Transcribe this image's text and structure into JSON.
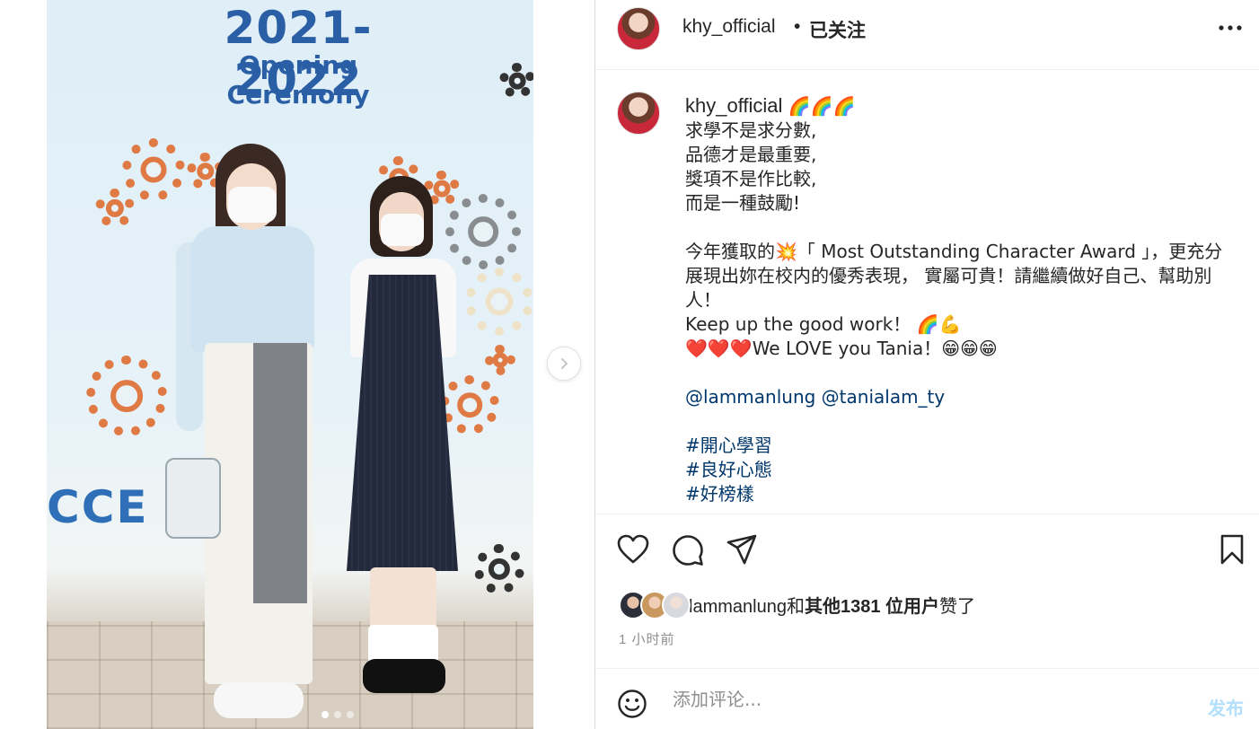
{
  "post": {
    "username": "khy_official",
    "separator": "•",
    "follow_state": "已关注",
    "more_icon": "more-options-icon"
  },
  "photo": {
    "banner_year": "2021-2022",
    "banner_subtitle": "Opening Ceremony",
    "banner_bottom": "CCE      GETH",
    "carousel_dots": 3,
    "carousel_active_index": 0
  },
  "caption": {
    "username": "khy_official",
    "user_emoji": "🌈🌈🌈",
    "lines": [
      "求學不是求分數,",
      "品德才是最重要,",
      "獎項不是作比較,",
      "而是一種鼓勵!",
      "",
      "今年獲取的💥「 Most Outstanding Character Award 」，更充分展現出妳在校内的優秀表現， 實屬可貴！請繼續做好自己、幫助別人！",
      "Keep up the good work！ 🌈💪",
      "❤️❤️❤️We LOVE you Tania！😁😁😁",
      ""
    ],
    "mentions": "@lammanlung @tanialam_ty",
    "hashtags": [
      "#開心學習",
      "#良好心態",
      "#好榜樣"
    ]
  },
  "actions": {
    "like_icon": "heart-icon",
    "comment_icon": "comment-icon",
    "share_icon": "share-icon",
    "save_icon": "bookmark-icon"
  },
  "likes": {
    "first_user": "lammanlung",
    "joiner": "和",
    "others": "其他1381 位用户",
    "suffix": "赞了"
  },
  "timestamp": "1 小时前",
  "comment": {
    "placeholder": "添加评论...",
    "post_label": "发布",
    "emoji_icon": "emoji-icon"
  },
  "colors": {
    "link": "#00376b",
    "post_button_disabled": "#b2dffc",
    "secondary_text": "#8e8e8e"
  }
}
